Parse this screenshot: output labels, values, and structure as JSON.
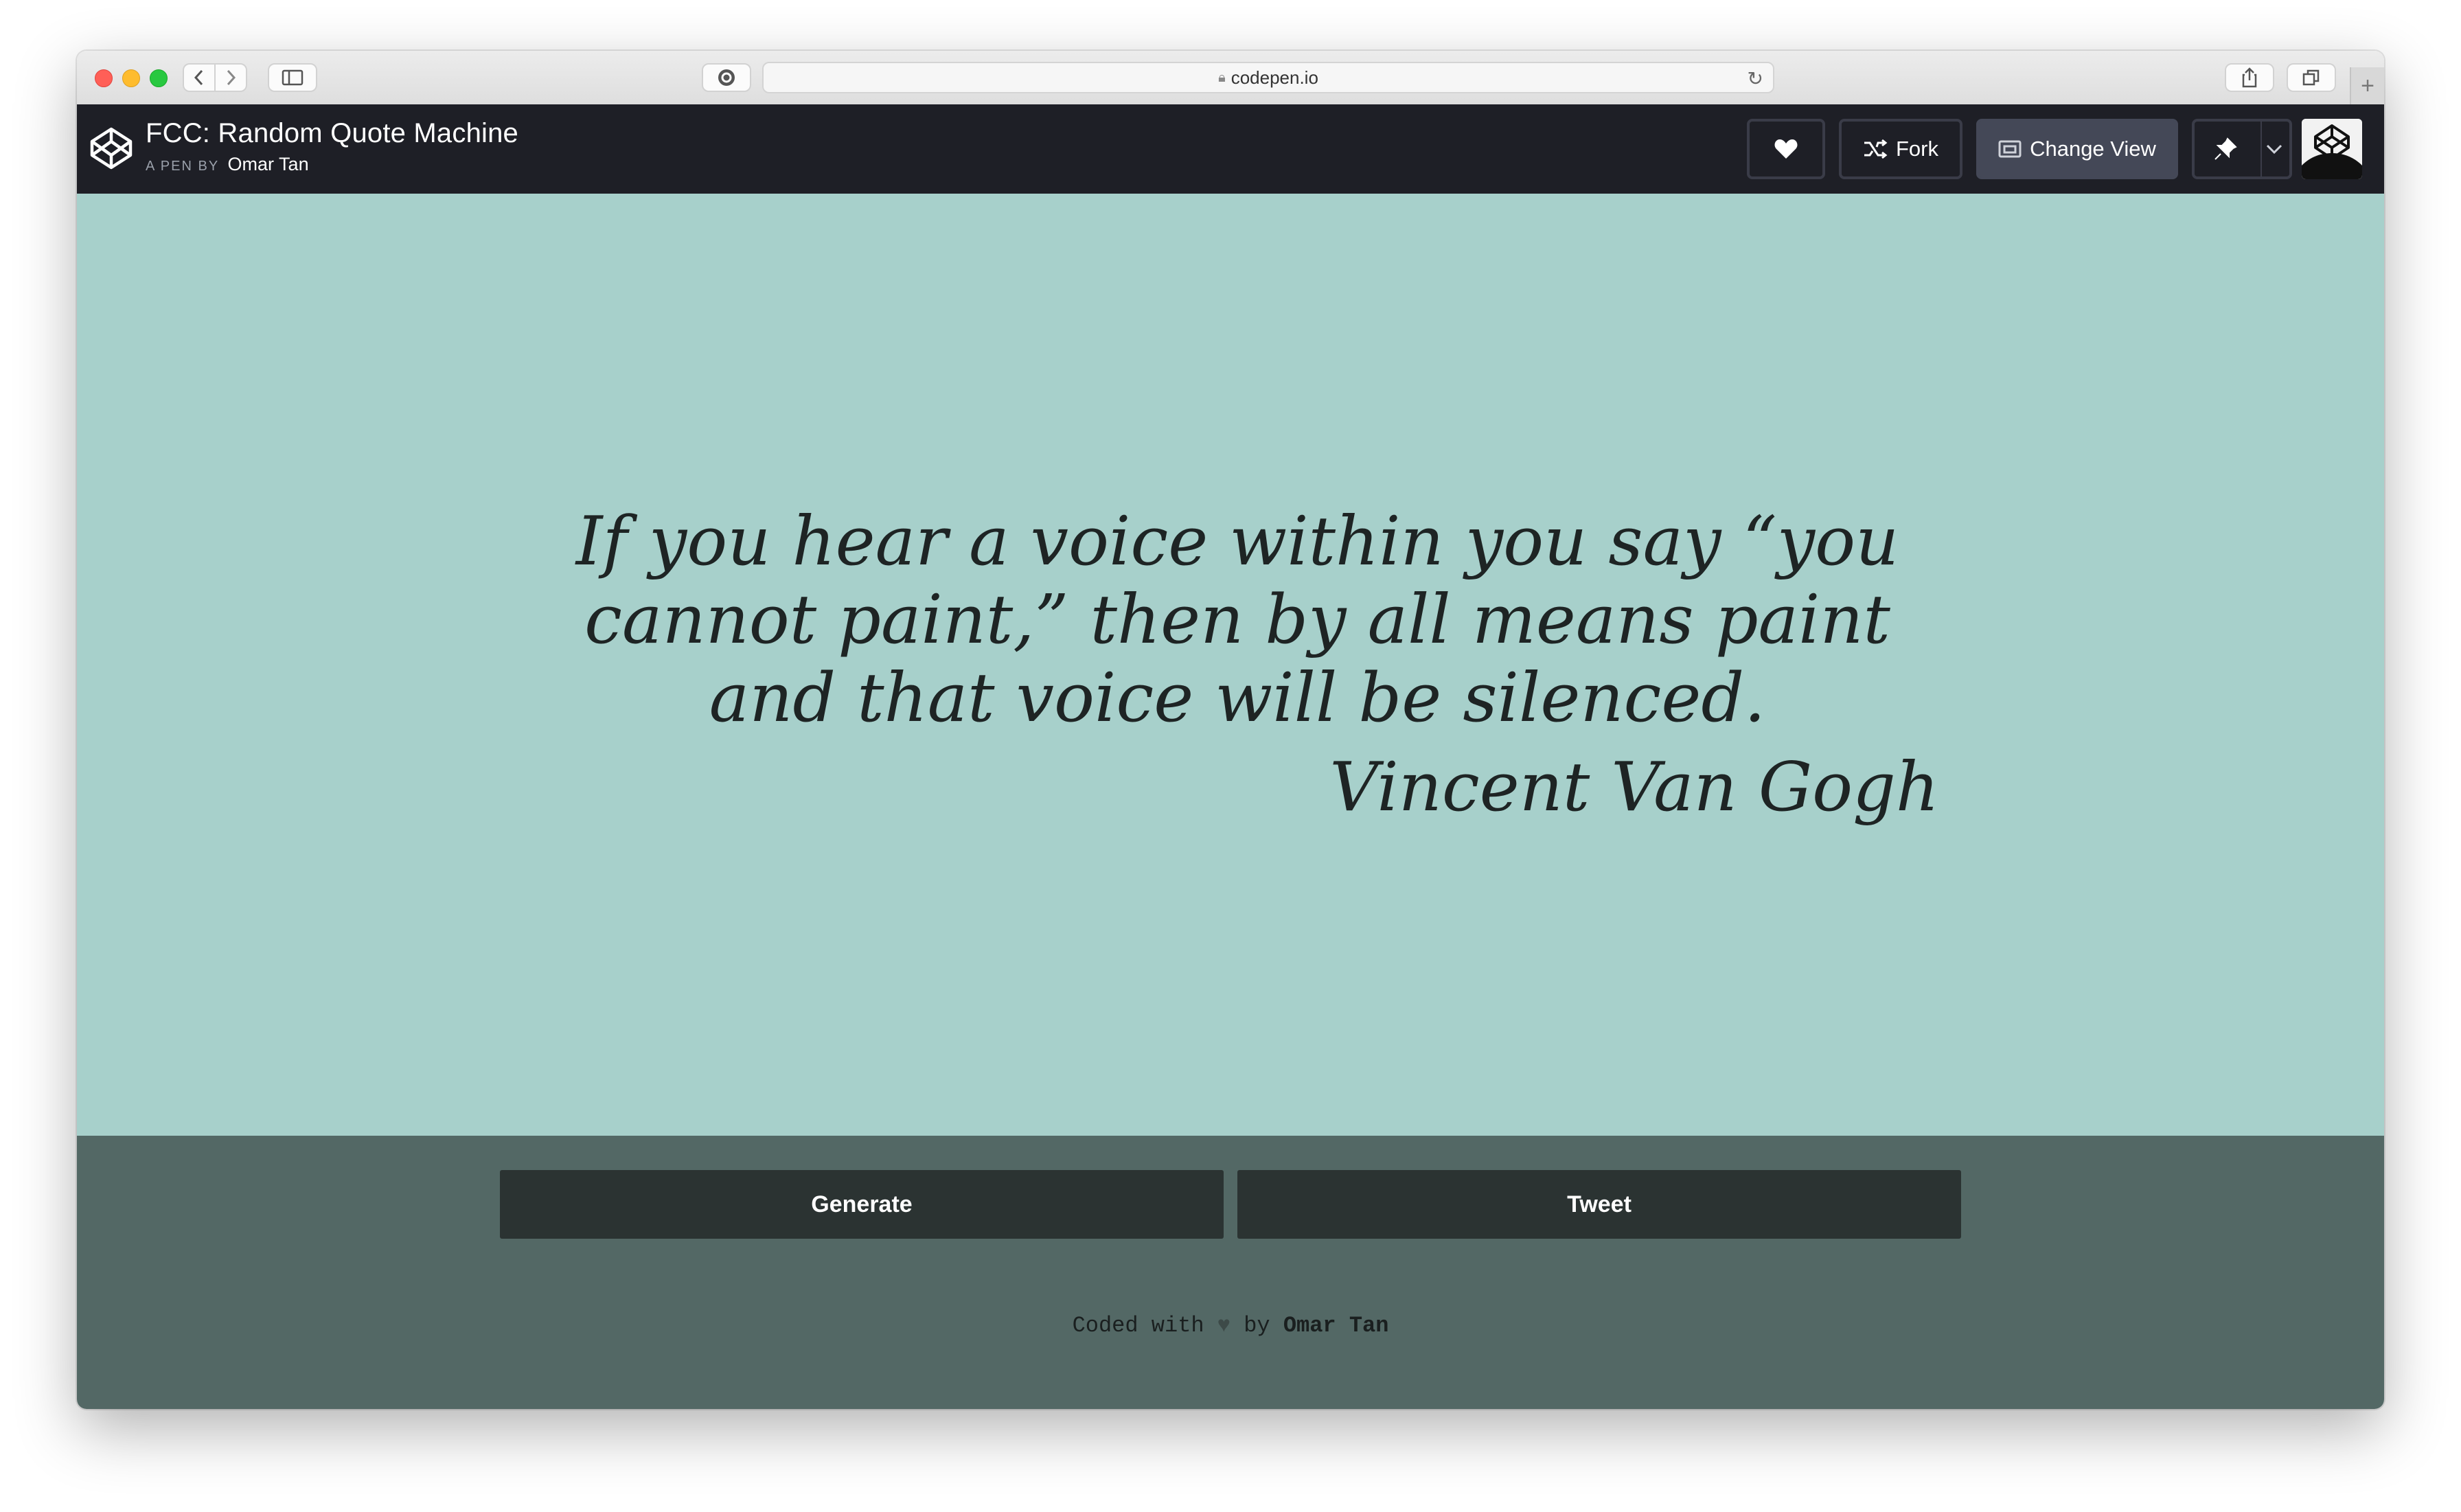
{
  "browser": {
    "url": "codepen.io",
    "icons": [
      "back-icon",
      "forward-icon",
      "sidebar-icon",
      "privacy-icon",
      "lock-icon",
      "reload-icon",
      "share-icon",
      "tabs-icon",
      "new-tab-icon"
    ]
  },
  "header": {
    "title": "FCC: Random Quote Machine",
    "by_label": "A PEN BY",
    "author": "Omar Tan",
    "fork_label": "Fork",
    "change_view_label": "Change View"
  },
  "quote": {
    "text": "If you hear a voice within you say “you cannot paint,” then by all means paint and that voice will be silenced.",
    "author": "Vincent Van Gogh"
  },
  "actions": {
    "generate_label": "Generate",
    "tweet_label": "Tweet"
  },
  "footer": {
    "prefix": "Coded with",
    "heart": "♥",
    "by": "by",
    "author": "Omar Tan"
  },
  "colors": {
    "quote_bg": "#a7d0cb",
    "footer_bg": "#536865",
    "button_bg": "#2b3332",
    "header_bg": "#1e1f26"
  }
}
